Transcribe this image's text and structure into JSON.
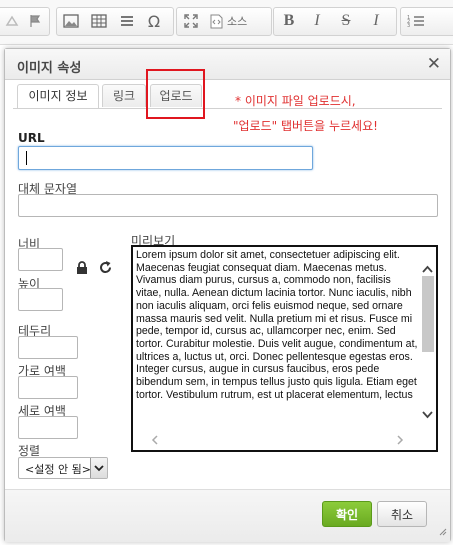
{
  "toolbar": {
    "icons": [
      "format-icon",
      "flag-icon",
      "image-icon",
      "table-icon",
      "horizontal-line-icon",
      "special-char-icon",
      "maximize-icon",
      "source-icon",
      "bold-icon",
      "italic-icon",
      "strike-icon",
      "remove-format-icon",
      "numbered-list-icon"
    ],
    "source_label": "소스",
    "special_char": "Ω",
    "bold": "B",
    "italic": "I",
    "strike": "S",
    "remove_format": "I"
  },
  "dialog": {
    "title": "이미지 속성",
    "close": "✕",
    "tabs": [
      {
        "label": "이미지 정보",
        "active": true
      },
      {
        "label": "링크",
        "active": false
      },
      {
        "label": "업로드",
        "active": false
      }
    ],
    "hint_line1": "* 이미지 파일 업로드시,",
    "hint_line2": "\"업로드\" 탭버튼을 누르세요!",
    "url_label": "URL",
    "url_value": "",
    "alt_label": "대체 문자열",
    "alt_value": "",
    "width_label": "너비",
    "height_label": "높이",
    "border_label": "테두리",
    "hspace_label": "가로 여백",
    "vspace_label": "세로 여백",
    "align_label": "정렬",
    "align_value": "<설정 안 됨>",
    "preview_label": "미리보기",
    "preview_text": "Lorem ipsum dolor sit amet, consectetuer adipiscing elit. Maecenas feugiat consequat diam. Maecenas metus. Vivamus diam purus, cursus a, commodo non, facilisis vitae, nulla. Aenean dictum lacinia tortor. Nunc iaculis, nibh non iaculis aliquam, orci felis euismod neque, sed ornare massa mauris sed velit. Nulla pretium mi et risus. Fusce mi pede, tempor id, cursus ac, ullamcorper nec, enim. Sed tortor. Curabitur molestie. Duis velit augue, condimentum at, ultrices a, luctus ut, orci. Donec pellentesque egestas eros. Integer cursus, augue in cursus faucibus, eros pede bibendum sem, in tempus tellus justo quis ligula. Etiam eget tortor. Vestibulum rutrum, est ut placerat elementum, lectus",
    "ok_label": "확인",
    "cancel_label": "취소"
  },
  "colors": {
    "ok_button": "#7ab82b",
    "hint_text": "#e03030",
    "highlight_box": "#e0161f"
  }
}
